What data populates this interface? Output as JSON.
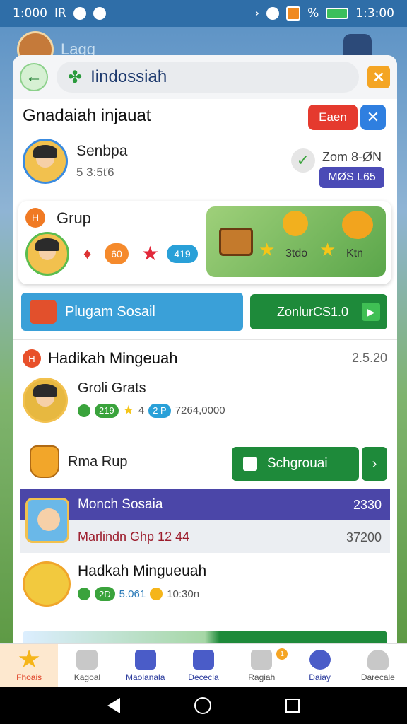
{
  "status_bar": {
    "time_left": "1:000",
    "carrier": "IR",
    "time_right": "1:3:00",
    "signal_text": "%"
  },
  "background": {
    "title": "Lagg"
  },
  "search": {
    "value": "Iindossiaħ"
  },
  "section1": {
    "title": "Gnadaiah injauat",
    "badge_red": "Eaen",
    "user_name": "Senbpa",
    "user_sub": "5 3:5ť6",
    "right_text": "Zom 8‑ØN",
    "pill": "MØS L65"
  },
  "grup": {
    "title": "Grup",
    "chip1": "60",
    "chip2": "419",
    "reward1": "3tdo",
    "reward2": "Ktn"
  },
  "cta": {
    "blue_label": "Plugam Sosail",
    "green_label": "ZonlurCS1.0"
  },
  "hadiah": {
    "title": "Hadikah Mingeuah",
    "number": "2.5.20",
    "sub": "Groli Grats",
    "chip1": "219",
    "star_val": "4",
    "chip2": "2 P",
    "amount": "7264,0000"
  },
  "rupiah": {
    "title": "Rma Rup",
    "button": "Schgrouai"
  },
  "purple": {
    "top_label": "Monch Sosaia",
    "top_value": "2330",
    "bot_label": "Marlindn Ghp 12 44",
    "bot_value": "37200"
  },
  "hadiah2": {
    "title": "Hadkah Mingueuah",
    "chip": "2D",
    "value1": "5.061",
    "value2": "10:30n"
  },
  "bottom_nav": [
    {
      "label": "Fhoais",
      "icon": "star-icon",
      "active": true
    },
    {
      "label": "Kagoal",
      "icon": "gift-icon"
    },
    {
      "label": "Maolanala",
      "icon": "tent-icon"
    },
    {
      "label": "Dececla",
      "icon": "checklist-icon"
    },
    {
      "label": "Ragiah",
      "icon": "chat-icon",
      "badge": "1"
    },
    {
      "label": "Daiay",
      "icon": "globe-icon"
    },
    {
      "label": "Darecale",
      "icon": "profile-icon"
    }
  ]
}
